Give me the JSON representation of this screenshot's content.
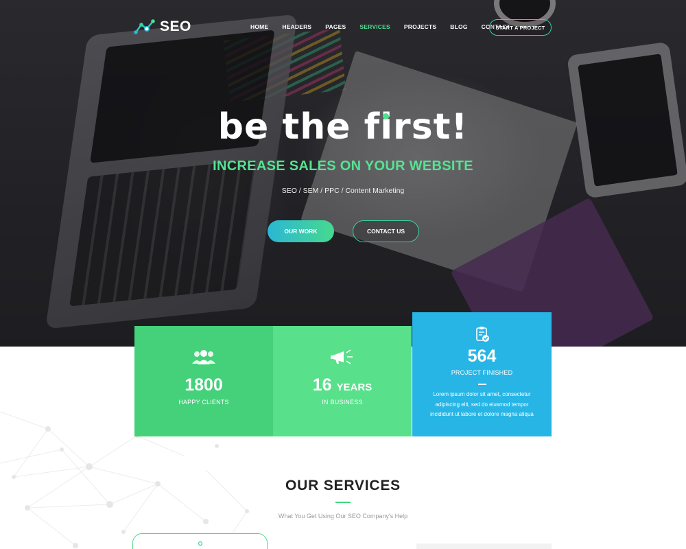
{
  "brand": {
    "name": "SEO",
    "accent": "#4ee08e",
    "secondary": "#27b5e6"
  },
  "nav": {
    "items": [
      {
        "label": "HOME",
        "active": false
      },
      {
        "label": "HEADERS",
        "active": false
      },
      {
        "label": "PAGES",
        "active": false
      },
      {
        "label": "SERVICES",
        "active": true
      },
      {
        "label": "PROJECTS",
        "active": false
      },
      {
        "label": "BLOG",
        "active": false
      },
      {
        "label": "CONTACT",
        "active": false
      }
    ],
    "cta_label": "START A PROJECT"
  },
  "hero": {
    "title": "be the first!",
    "subtitle": "INCREASE SALES ON YOUR WEBSITE",
    "tags": "SEO / SEM / PPC / Content Marketing",
    "primary_button": "OUR WORK",
    "secondary_button": "CONTACT US"
  },
  "stats": [
    {
      "icon": "users-icon",
      "number": "1800",
      "unit": "",
      "label": "HAPPY CLIENTS",
      "color": "#44d17a"
    },
    {
      "icon": "megaphone-icon",
      "number": "16",
      "unit": "YEARS",
      "label": "IN BUSINESS",
      "color": "#58e08a"
    },
    {
      "icon": "clipboard-check-icon",
      "number": "564",
      "unit": "",
      "label": "PROJECT FINISHED",
      "color": "#27b5e6",
      "description": "Lorem ipsum dolor sit amet, consectetur adipiscing elit, sed do eiusmod tempor incididunt ut labore et dolore magna aliqua"
    }
  ],
  "services": {
    "title": "OUR SERVICES",
    "subtitle": "What You Get Using Our SEO Company's Help"
  }
}
